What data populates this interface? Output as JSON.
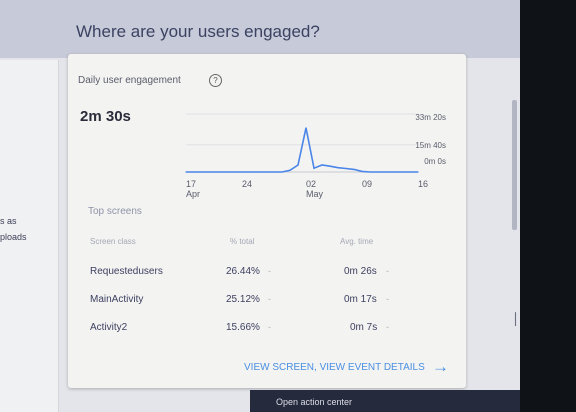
{
  "section": {
    "title": "Where are your users engaged?"
  },
  "left_card": {
    "line1": "s as",
    "line2": "ploads"
  },
  "engagement": {
    "title": "Daily user engagement",
    "help_icon": "help-circle-icon",
    "value": "2m 30s"
  },
  "chart_data": {
    "type": "line",
    "x": [
      "17 Apr",
      "18 Apr",
      "19 Apr",
      "20 Apr",
      "21 Apr",
      "22 Apr",
      "23 Apr",
      "24 Apr",
      "25 Apr",
      "26 Apr",
      "27 Apr",
      "28 Apr",
      "29 Apr",
      "30 Apr",
      "01 May",
      "02 May",
      "03 May",
      "04 May",
      "05 May",
      "06 May",
      "07 May",
      "08 May",
      "09 May",
      "10 May",
      "11 May",
      "12 May",
      "13 May",
      "14 May",
      "15 May",
      "16 May"
    ],
    "series": [
      {
        "values": [
          0,
          0,
          0,
          0,
          0,
          0,
          0,
          0,
          0,
          0,
          0,
          0,
          0,
          60,
          240,
          1520,
          130,
          240,
          200,
          150,
          120,
          90,
          20,
          0,
          0,
          0,
          0,
          0,
          0,
          0
        ]
      }
    ],
    "y_tick_labels": [
      "33m 20s",
      "15m 40s",
      "0m 0s"
    ],
    "y_tick_values": [
      2000,
      940,
      0
    ],
    "ylim": [
      0,
      2000
    ],
    "x_tick_labels": [
      {
        "day": "17",
        "month": "Apr"
      },
      {
        "day": "24",
        "month": ""
      },
      {
        "day": "02",
        "month": "May"
      },
      {
        "day": "09",
        "month": ""
      },
      {
        "day": "16",
        "month": ""
      }
    ],
    "x_tick_dates": [
      "17 Apr",
      "24 Apr",
      "02 May",
      "09 May",
      "16 May"
    ],
    "line_color": "#4a85e8",
    "grid": true
  },
  "top_screens": {
    "title": "Top screens",
    "headers": {
      "screen": "Screen class",
      "pct": "% total",
      "time": "Avg. time"
    },
    "rows": [
      {
        "screen": "Requestedusers",
        "pct": "26.44%",
        "time": "0m 26s"
      },
      {
        "screen": "MainActivity",
        "pct": "25.12%",
        "time": "0m 17s"
      },
      {
        "screen": "Activity2",
        "pct": "15.66%",
        "time": "0m 7s"
      }
    ],
    "link": "VIEW SCREEN, VIEW EVENT DETAILS",
    "link_icon": "arrow-right-icon"
  },
  "overlay": {
    "text": "Open action center"
  },
  "colors": {
    "accent": "#4a90e2",
    "header_band": "#c7cad8",
    "overlay": "#262a3d"
  }
}
